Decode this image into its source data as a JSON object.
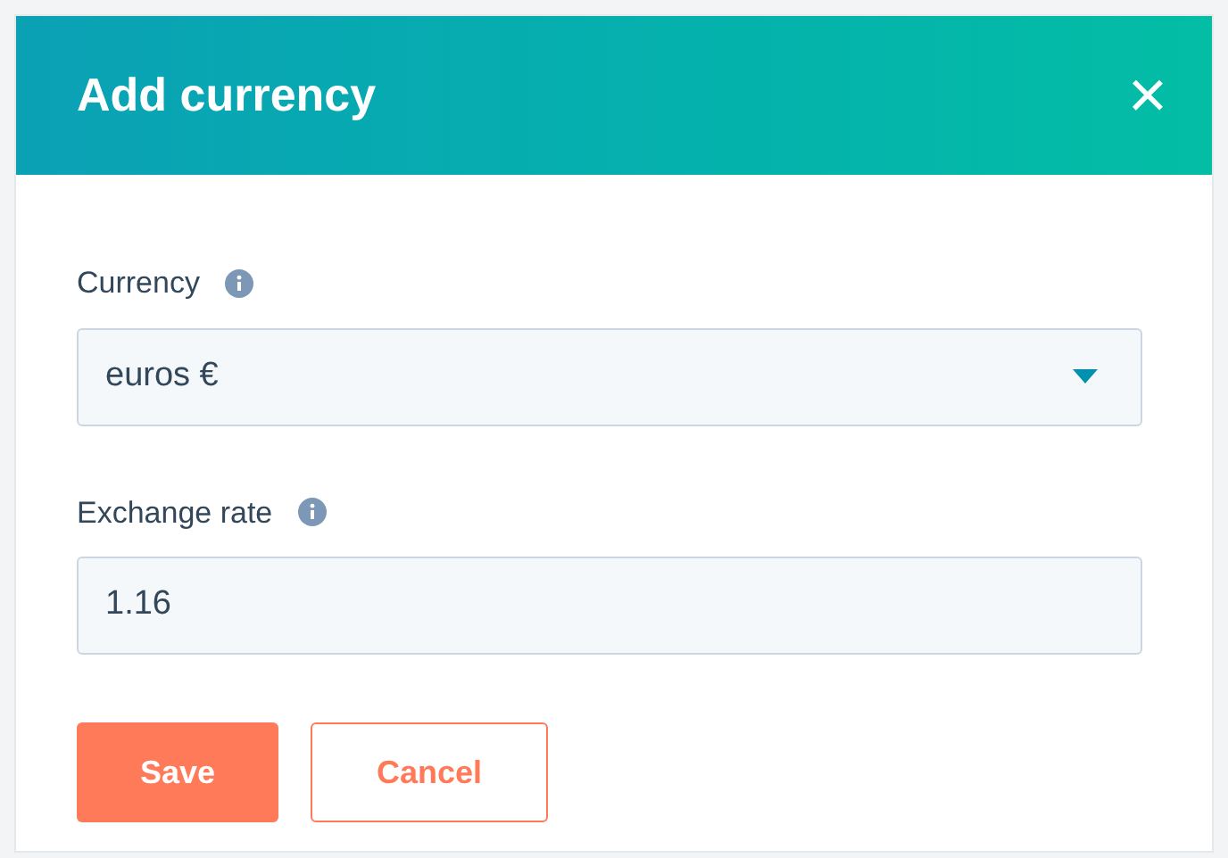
{
  "dialog": {
    "title": "Add currency",
    "close": "×"
  },
  "fields": [
    {
      "kind": "select",
      "label": "Currency",
      "value": "euros €"
    },
    {
      "kind": "input",
      "label": "Exchange rate",
      "value": "1.16"
    }
  ],
  "buttons": [
    {
      "kind": "primary",
      "label": "Save"
    },
    {
      "kind": "secondary",
      "label": "Cancel"
    }
  ]
}
